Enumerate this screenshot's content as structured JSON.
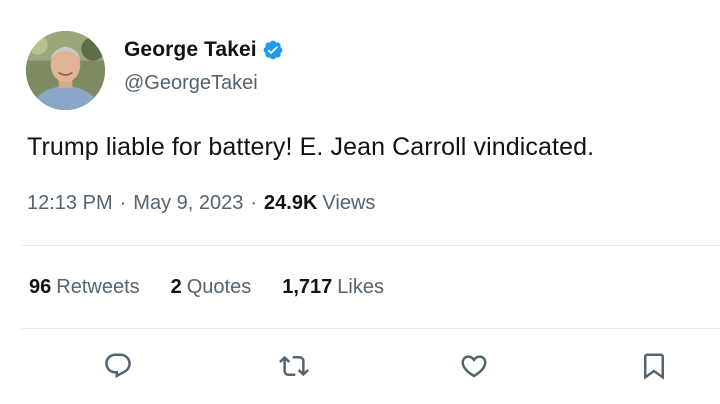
{
  "author": {
    "display_name": "George Takei",
    "handle": "@GeorgeTakei",
    "verified": true,
    "verified_icon": "verified-badge-icon",
    "verified_color": "#1d9bf0"
  },
  "tweet": {
    "text": "Trump liable for battery! E. Jean Carroll vindicated."
  },
  "meta": {
    "time": "12:13 PM",
    "separator": "·",
    "date": "May 9, 2023",
    "views_count": "24.9K",
    "views_label": "Views"
  },
  "stats": {
    "retweets_count": "96",
    "retweets_label": "Retweets",
    "quotes_count": "2",
    "quotes_label": "Quotes",
    "likes_count": "1,717",
    "likes_label": "Likes"
  },
  "actions": [
    {
      "name": "reply",
      "icon": "reply-icon"
    },
    {
      "name": "retweet",
      "icon": "retweet-icon"
    },
    {
      "name": "like",
      "icon": "heart-icon"
    },
    {
      "name": "bookmark",
      "icon": "bookmark-icon"
    }
  ],
  "colors": {
    "text_primary": "#0f1419",
    "text_secondary": "#536471",
    "divider": "#e6e9ea"
  }
}
